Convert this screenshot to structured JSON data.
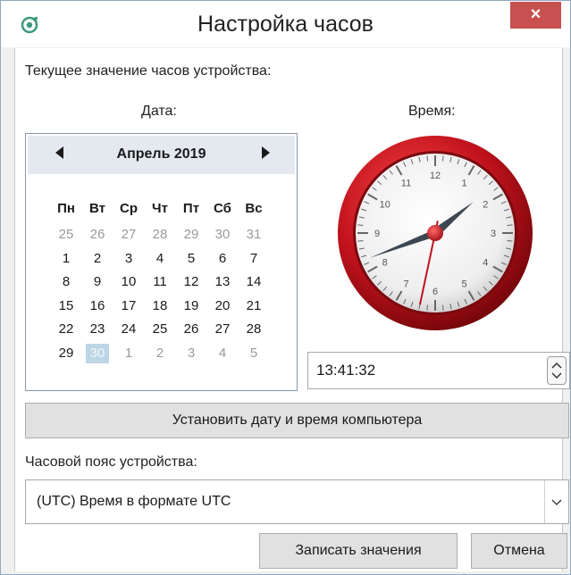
{
  "window": {
    "title": "Настройка часов",
    "close_label": "×",
    "app_icon": "gear-sync-icon"
  },
  "device_clock_label": "Текущее значение часов устройства:",
  "date_label": "Дата:",
  "time_label": "Время:",
  "calendar": {
    "month_title": "Апрель 2019",
    "weekdays": [
      "Пн",
      "Вт",
      "Ср",
      "Чт",
      "Пт",
      "Сб",
      "Вс"
    ],
    "weeks": [
      [
        "25",
        "26",
        "27",
        "28",
        "29",
        "30",
        "31"
      ],
      [
        "1",
        "2",
        "3",
        "4",
        "5",
        "6",
        "7"
      ],
      [
        "8",
        "9",
        "10",
        "11",
        "12",
        "13",
        "14"
      ],
      [
        "15",
        "16",
        "17",
        "18",
        "19",
        "20",
        "21"
      ],
      [
        "22",
        "23",
        "24",
        "25",
        "26",
        "27",
        "28"
      ],
      [
        "29",
        "30",
        "1",
        "2",
        "3",
        "4",
        "5"
      ]
    ],
    "selected_day": "30",
    "prev_icon": "triangle-left-icon",
    "next_icon": "triangle-right-icon"
  },
  "clock": {
    "hour": 13,
    "minute": 41,
    "second": 32,
    "numbers": [
      "12",
      "1",
      "2",
      "3",
      "4",
      "5",
      "6",
      "7",
      "8",
      "9",
      "10",
      "11"
    ],
    "rim_color": "#c0121c",
    "hand_color": "#3c4752",
    "second_hand_color": "#c0121c"
  },
  "time_input": {
    "value": "13:41:32",
    "spinner_icon": "up-down-spinner-icon"
  },
  "set_computer_time_button": "Установить дату и время компьютера",
  "timezone_label": "Часовой пояс устройства:",
  "timezone_select": {
    "value": "(UTC) Время в формате UTC",
    "arrow_icon": "chevron-down-icon"
  },
  "write_button": "Записать значения",
  "cancel_button": "Отмена",
  "colors": {
    "close": "#c75050",
    "calendar_header": "#e3e9ef",
    "selected_day": "#bcd6e6"
  }
}
